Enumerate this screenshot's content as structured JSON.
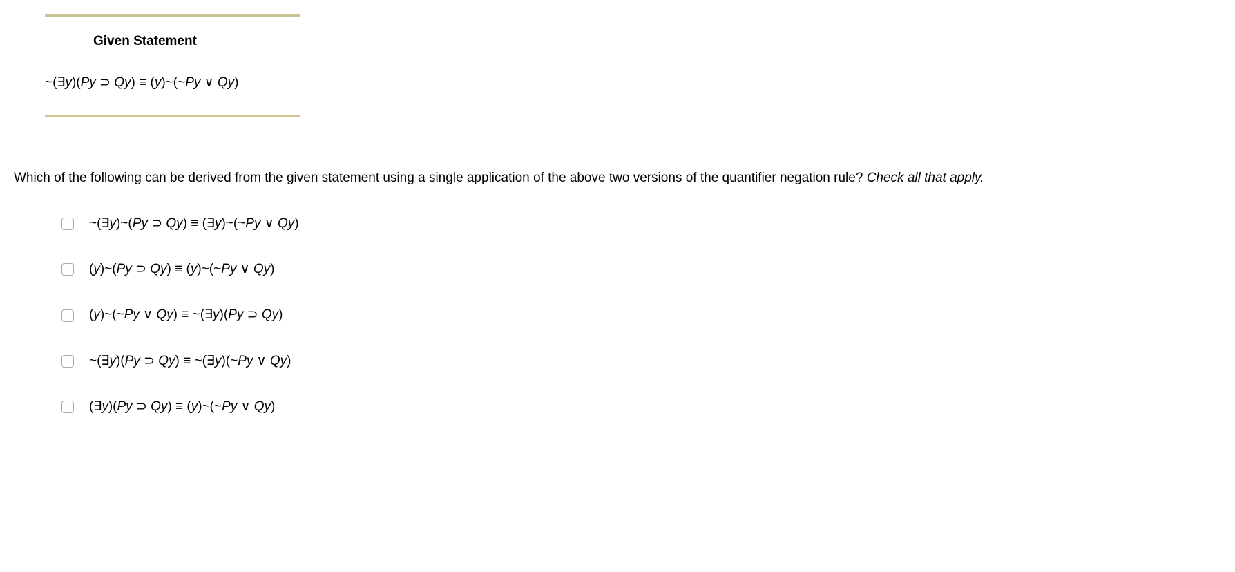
{
  "given": {
    "header": "Given Statement",
    "statement_html": "<span class='op'>~(∃</span>y<span class='op'>)(</span>Py <span class='op'>⊃</span> Qy<span class='op'>) ≡ (</span>y<span class='op'>)~(~</span>Py <span class='op'>∨</span> Qy<span class='op'>)</span>"
  },
  "question": {
    "text": "Which of the following can be derived from the given statement using a single application of the above two versions of the quantifier negation rule? ",
    "hint": "Check all that apply."
  },
  "options": [
    "<span class='op'>~(∃</span>y<span class='op'>)~(</span>Py <span class='op'>⊃</span> Qy<span class='op'>) ≡ (∃</span>y<span class='op'>)~(~</span>Py <span class='op'>∨</span> Qy<span class='op'>)</span>",
    "<span class='op'>(</span>y<span class='op'>)~(</span>Py <span class='op'>⊃</span> Qy<span class='op'>) ≡ (</span>y<span class='op'>)~(~</span>Py <span class='op'>∨</span> Qy<span class='op'>)</span>",
    "<span class='op'>(</span>y<span class='op'>)~(~</span>Py <span class='op'>∨</span> Qy<span class='op'>) ≡ ~(∃</span>y<span class='op'>)(</span>Py <span class='op'>⊃</span> Qy<span class='op'>)</span>",
    "<span class='op'>~(∃</span>y<span class='op'>)(</span>Py <span class='op'>⊃</span> Qy<span class='op'>) ≡ ~(∃</span>y<span class='op'>)(~</span>Py <span class='op'>∨</span> Qy<span class='op'>)</span>",
    "<span class='op'>(∃</span>y<span class='op'>)(</span>Py <span class='op'>⊃</span> Qy<span class='op'>) ≡ (</span>y<span class='op'>)~(~</span>Py <span class='op'>∨</span> Qy<span class='op'>)</span>"
  ]
}
